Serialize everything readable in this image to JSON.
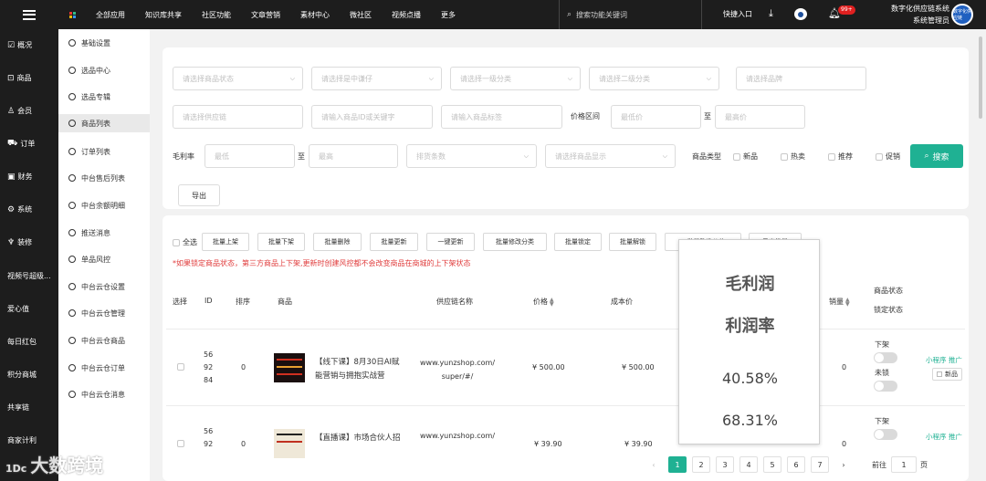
{
  "topbar": {
    "nav": [
      "全部应用",
      "知识库共享",
      "社区功能",
      "文章营销",
      "素材中心",
      "微社区",
      "视频点播",
      "更多"
    ],
    "search_placeholder": "搜索功能关键词",
    "quick_entry": "快捷入口",
    "notif_badge": "99+",
    "user_line1": "数字化供应链系统",
    "user_line2": "系统管理员",
    "avatar_text": "数字化供应链"
  },
  "sidebar1": [
    "概况",
    "商品",
    "会员",
    "订单",
    "财务",
    "系统",
    "装修",
    "视频号超级...",
    "爱心值",
    "每日红包",
    "积分商城",
    "共享链",
    "商家计利"
  ],
  "sidebar2": [
    "基础设置",
    "选品中心",
    "选品专辑",
    "商品列表",
    "订单列表",
    "中台售后列表",
    "中台余额明细",
    "推送消息",
    "单品风控",
    "中台云仓设置",
    "中台云仓管理",
    "中台云仓商品",
    "中台云仓订单",
    "中台云仓消息"
  ],
  "filters": {
    "status": "请选择商品状态",
    "supplier_stock": "请选择是中谦仔",
    "cat1": "请选择一级分类",
    "cat2": "请选择二级分类",
    "brand": "请选择品牌",
    "supply_chain": "请选择供应链",
    "keyword": "请输入商品ID或关键字",
    "tag": "请输入商品标签",
    "price_label": "价格区间",
    "price_min": "最低价",
    "to": "至",
    "price_max": "最高价",
    "margin_label": "毛利率",
    "margin_min": "最低",
    "margin_max": "最高",
    "sort": "排货条数",
    "display": "请选择商品显示",
    "type_label": "商品类型",
    "type_new": "新品",
    "type_hot": "热卖",
    "type_rec": "推荐",
    "type_promo": "促销",
    "search_btn": "搜索",
    "export_btn": "导出"
  },
  "actions": {
    "select_all": "全选",
    "buttons": [
      "批量上架",
      "批量下架",
      "批量删除",
      "批量更新",
      "一键更新",
      "批量修改分类",
      "批量锁定",
      "批量解锁",
      "一批量改造价格",
      "导出批量"
    ],
    "warning": "*如果锁定商品状态，第三方商品上下架,更新时创建风控都不会改变商品在商城的上下架状态"
  },
  "columns": {
    "select": "选择",
    "id": "ID",
    "rank": "排序",
    "product": "商品",
    "supplier": "供应链名称",
    "price": "价格",
    "cost": "成本价",
    "sales": "销量",
    "status": "商品状态",
    "lock": "锁定状态"
  },
  "rows": [
    {
      "id": [
        "56",
        "92",
        "84"
      ],
      "rank": "0",
      "title": [
        "【线下课】8月30日AI赋",
        "能营销与拥抱实战营"
      ],
      "supplier": [
        "www.yunzshop.com/",
        "super/#/"
      ],
      "price": "¥ 500.00",
      "cost": "¥ 500.00",
      "sales": "0",
      "status_up": "下架",
      "status_lock": "未锁",
      "link": "小程序  推广",
      "tag": "新品"
    },
    {
      "id": [
        "56",
        "92",
        ""
      ],
      "rank": "0",
      "title": [
        "【直播课】市场合伙人招",
        ""
      ],
      "supplier": [
        "www.yunzshop.com/",
        ""
      ],
      "price": "¥ 39.90",
      "cost": "¥ 39.90",
      "sales": "0",
      "status_up": "下架",
      "status_lock": "",
      "link": "小程序  推广",
      "tag": ""
    }
  ],
  "popup": {
    "title1": "毛利润",
    "title2": "利润率",
    "value1": "40.58%",
    "value2": "68.31%"
  },
  "pagination": {
    "pages": [
      "1",
      "2",
      "3",
      "4",
      "5",
      "6",
      "7"
    ],
    "active": "1",
    "goto_label": "前往",
    "goto_value": "1",
    "page_unit": "页"
  },
  "watermark": {
    "logo": "1Dc",
    "text": "大数跨境"
  }
}
